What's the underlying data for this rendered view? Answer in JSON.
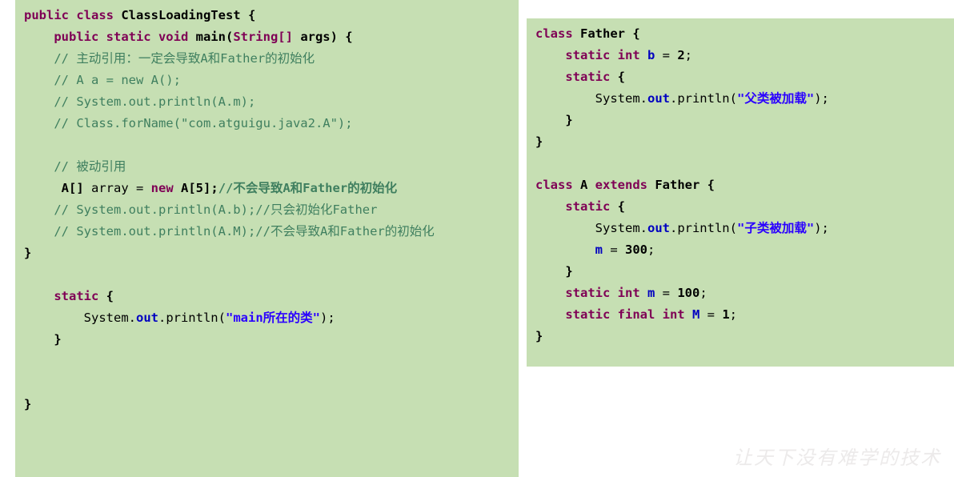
{
  "page": {
    "title": "Java ClassLoadingTest code sample",
    "background_color": "#ffffff",
    "code_background_color": "#c6dfb3"
  },
  "theme": {
    "keyword_color": "#7f0055",
    "comment_color": "#3f7f5f",
    "string_color": "#2a00ff",
    "field_color": "#0000c0",
    "plain_color": "#000000",
    "watermark_color": "#eceaea"
  },
  "left_block": {
    "name": "ClassLoadingTest",
    "lines": [
      {
        "id": "l1",
        "segments": [
          {
            "t": "public class ",
            "c": "kw"
          },
          {
            "t": "ClassLoadingTest ",
            "c": "bld"
          },
          {
            "t": "{",
            "c": "bld"
          }
        ]
      },
      {
        "id": "l2",
        "segments": [
          {
            "t": "    ",
            "c": "plain"
          },
          {
            "t": "public static void ",
            "c": "kw"
          },
          {
            "t": "main(",
            "c": "bld"
          },
          {
            "t": "String[] ",
            "c": "kw"
          },
          {
            "t": "args) {",
            "c": "bld"
          }
        ]
      },
      {
        "id": "l3",
        "segments": [
          {
            "t": "    // 主动引用：一定会导致A和Father的初始化",
            "c": "cmt"
          }
        ]
      },
      {
        "id": "l4",
        "segments": [
          {
            "t": "    // A a = new A();",
            "c": "cmt"
          }
        ]
      },
      {
        "id": "l5",
        "segments": [
          {
            "t": "    // System.out.println(A.m);",
            "c": "cmt"
          }
        ]
      },
      {
        "id": "l6",
        "segments": [
          {
            "t": "    // Class.forName(\"com.atguigu.java2.A\");",
            "c": "cmt"
          }
        ]
      },
      {
        "id": "l7",
        "segments": [
          {
            "t": " ",
            "c": "plain"
          }
        ]
      },
      {
        "id": "l8",
        "segments": [
          {
            "t": "    // 被动引用",
            "c": "cmt"
          }
        ]
      },
      {
        "id": "l9",
        "segments": [
          {
            "t": "     ",
            "c": "plain"
          },
          {
            "t": "A[] ",
            "c": "bld"
          },
          {
            "t": "array ",
            "c": "plain"
          },
          {
            "t": "= ",
            "c": "plain"
          },
          {
            "t": "new ",
            "c": "kw"
          },
          {
            "t": "A[",
            "c": "bld"
          },
          {
            "t": "5",
            "c": "num"
          },
          {
            "t": "];",
            "c": "bld"
          },
          {
            "t": "//不会导致A和Father的初始化",
            "c": "cmt-b"
          }
        ]
      },
      {
        "id": "l10",
        "segments": [
          {
            "t": "    // System.out.println(A.b);//只会初始化Father",
            "c": "cmt"
          }
        ]
      },
      {
        "id": "l11",
        "segments": [
          {
            "t": "    // System.out.println(A.M);//不会导致A和Father的初始化",
            "c": "cmt"
          }
        ]
      },
      {
        "id": "l12",
        "segments": [
          {
            "t": "}",
            "c": "bld"
          }
        ]
      },
      {
        "id": "l13",
        "segments": [
          {
            "t": " ",
            "c": "plain"
          }
        ]
      },
      {
        "id": "l14",
        "segments": [
          {
            "t": "    ",
            "c": "plain"
          },
          {
            "t": "static ",
            "c": "kw"
          },
          {
            "t": "{",
            "c": "bld"
          }
        ]
      },
      {
        "id": "l15",
        "segments": [
          {
            "t": "        System.",
            "c": "plain"
          },
          {
            "t": "out",
            "c": "fld"
          },
          {
            "t": ".println(",
            "c": "plain"
          },
          {
            "t": "\"",
            "c": "quot"
          },
          {
            "t": "main所在的类",
            "c": "str"
          },
          {
            "t": "\"",
            "c": "quot"
          },
          {
            "t": ");",
            "c": "plain"
          }
        ]
      },
      {
        "id": "l16",
        "segments": [
          {
            "t": "    }",
            "c": "bld"
          }
        ]
      },
      {
        "id": "l17",
        "segments": [
          {
            "t": " ",
            "c": "plain"
          }
        ]
      },
      {
        "id": "l18",
        "segments": [
          {
            "t": " ",
            "c": "plain"
          }
        ]
      },
      {
        "id": "l19",
        "segments": [
          {
            "t": "}",
            "c": "bld"
          }
        ]
      }
    ]
  },
  "right_block": {
    "classes": [
      "Father",
      "A"
    ],
    "lines": [
      {
        "id": "r1",
        "segments": [
          {
            "t": "class ",
            "c": "kw"
          },
          {
            "t": "Father ",
            "c": "bld"
          },
          {
            "t": "{",
            "c": "bld"
          }
        ]
      },
      {
        "id": "r2",
        "segments": [
          {
            "t": "    ",
            "c": "plain"
          },
          {
            "t": "static int ",
            "c": "kw"
          },
          {
            "t": "b ",
            "c": "fld"
          },
          {
            "t": "= ",
            "c": "plain"
          },
          {
            "t": "2",
            "c": "num"
          },
          {
            "t": ";",
            "c": "plain"
          }
        ]
      },
      {
        "id": "r3",
        "segments": [
          {
            "t": "    ",
            "c": "plain"
          },
          {
            "t": "static ",
            "c": "kw"
          },
          {
            "t": "{",
            "c": "bld"
          }
        ]
      },
      {
        "id": "r4",
        "segments": [
          {
            "t": "        System.",
            "c": "plain"
          },
          {
            "t": "out",
            "c": "fld"
          },
          {
            "t": ".println(",
            "c": "plain"
          },
          {
            "t": "\"",
            "c": "quot"
          },
          {
            "t": "父类被加载",
            "c": "str"
          },
          {
            "t": "\"",
            "c": "quot"
          },
          {
            "t": ");",
            "c": "plain"
          }
        ]
      },
      {
        "id": "r5",
        "segments": [
          {
            "t": "    }",
            "c": "bld"
          }
        ]
      },
      {
        "id": "r6",
        "segments": [
          {
            "t": "}",
            "c": "bld"
          }
        ]
      },
      {
        "id": "r7",
        "segments": [
          {
            "t": " ",
            "c": "plain"
          }
        ]
      },
      {
        "id": "r8",
        "segments": [
          {
            "t": "class ",
            "c": "kw"
          },
          {
            "t": "A ",
            "c": "bld"
          },
          {
            "t": "extends ",
            "c": "kw"
          },
          {
            "t": "Father ",
            "c": "bld"
          },
          {
            "t": "{",
            "c": "bld"
          }
        ]
      },
      {
        "id": "r9",
        "segments": [
          {
            "t": "    ",
            "c": "plain"
          },
          {
            "t": "static ",
            "c": "kw"
          },
          {
            "t": "{",
            "c": "bld"
          }
        ]
      },
      {
        "id": "r10",
        "segments": [
          {
            "t": "        System.",
            "c": "plain"
          },
          {
            "t": "out",
            "c": "fld"
          },
          {
            "t": ".println(",
            "c": "plain"
          },
          {
            "t": "\"",
            "c": "quot"
          },
          {
            "t": "子类被加载",
            "c": "str"
          },
          {
            "t": "\"",
            "c": "quot"
          },
          {
            "t": ");",
            "c": "plain"
          }
        ]
      },
      {
        "id": "r11",
        "segments": [
          {
            "t": "        ",
            "c": "plain"
          },
          {
            "t": "m ",
            "c": "fld"
          },
          {
            "t": "= ",
            "c": "plain"
          },
          {
            "t": "300",
            "c": "num"
          },
          {
            "t": ";",
            "c": "plain"
          }
        ]
      },
      {
        "id": "r12",
        "segments": [
          {
            "t": "    }",
            "c": "bld"
          }
        ]
      },
      {
        "id": "r13",
        "segments": [
          {
            "t": "    ",
            "c": "plain"
          },
          {
            "t": "static int ",
            "c": "kw"
          },
          {
            "t": "m ",
            "c": "fld"
          },
          {
            "t": "= ",
            "c": "plain"
          },
          {
            "t": "100",
            "c": "num"
          },
          {
            "t": ";",
            "c": "plain"
          }
        ]
      },
      {
        "id": "r14",
        "segments": [
          {
            "t": "    ",
            "c": "plain"
          },
          {
            "t": "static final int ",
            "c": "kw"
          },
          {
            "t": "M ",
            "c": "fld"
          },
          {
            "t": "= ",
            "c": "plain"
          },
          {
            "t": "1",
            "c": "num"
          },
          {
            "t": ";",
            "c": "plain"
          }
        ]
      },
      {
        "id": "r15",
        "segments": [
          {
            "t": "}",
            "c": "bld"
          }
        ]
      }
    ]
  },
  "watermark": {
    "text": "让天下没有难学的技术"
  }
}
